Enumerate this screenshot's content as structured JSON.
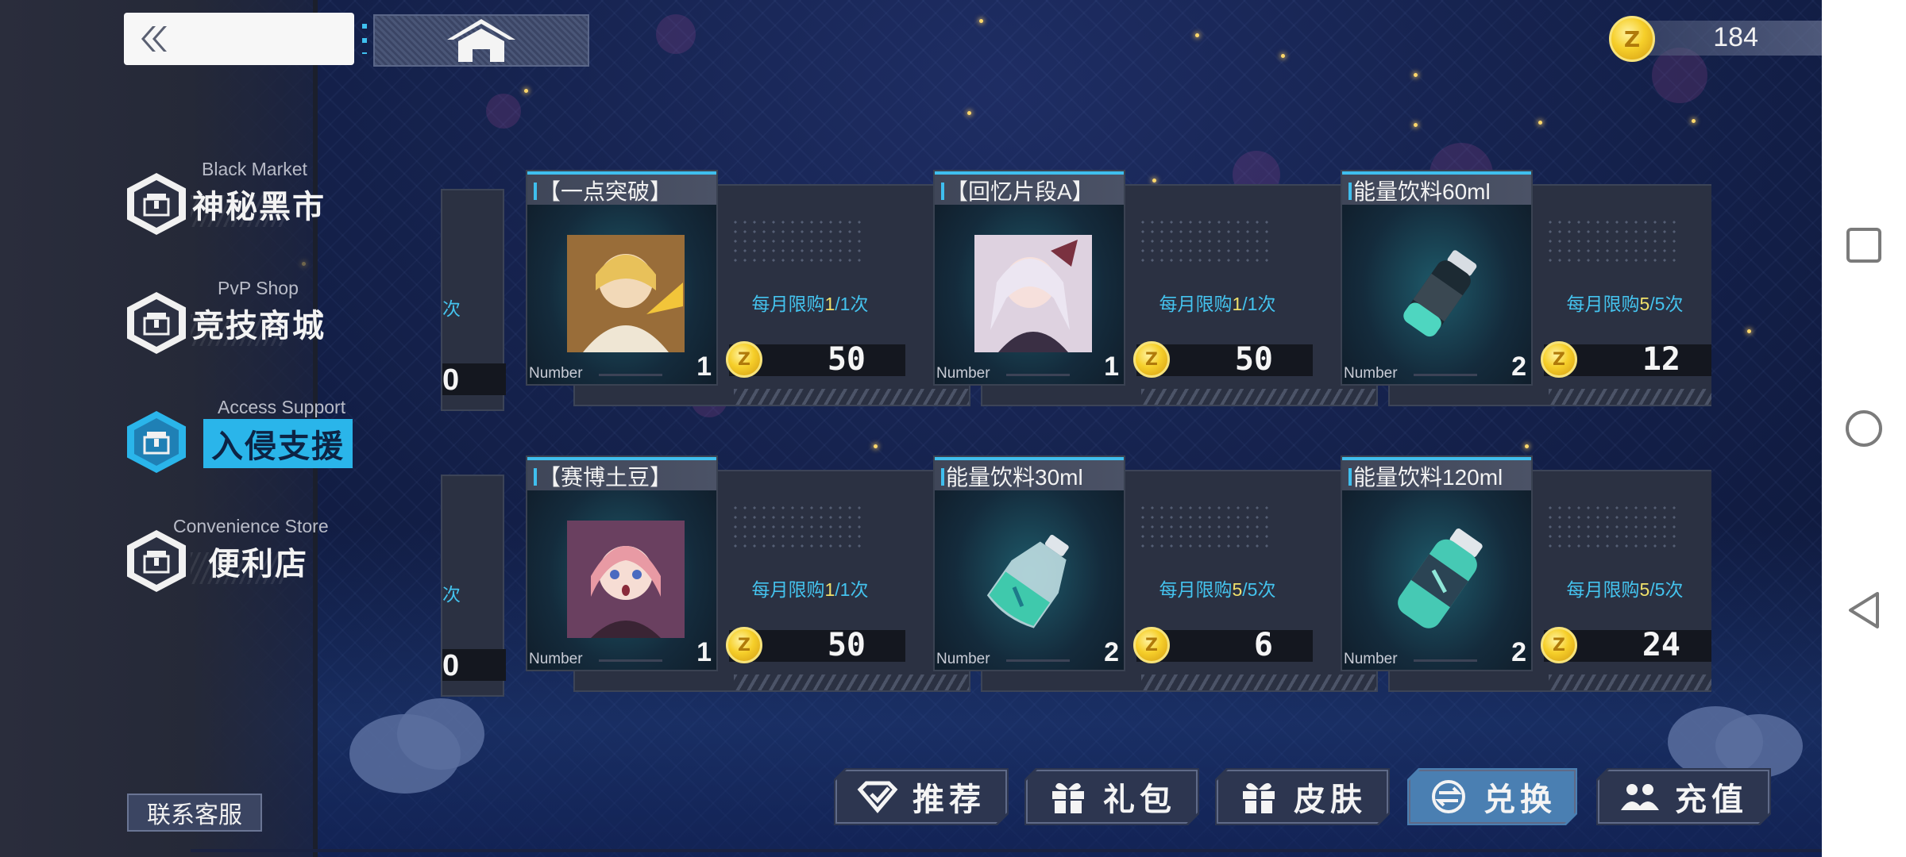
{
  "topbar": {
    "currency_amount": "184",
    "coin_glyph": "Z"
  },
  "sidebar": {
    "items": [
      {
        "en": "Black Market",
        "zh": "神秘黑市"
      },
      {
        "en": "PvP Shop",
        "zh": "竞技商城"
      },
      {
        "en": "Access Support",
        "zh": "入侵支援"
      },
      {
        "en": "Convenience Store",
        "zh": "便利店"
      }
    ],
    "active_index": 2
  },
  "number_label": "Number",
  "partial_cards": [
    {
      "limit_suffix": "次",
      "price_tail": "0"
    },
    {
      "limit_suffix": "次",
      "price_tail": "0"
    }
  ],
  "items": [
    {
      "title": "【一点突破】",
      "qty": "1",
      "limit_prefix": "每月限购",
      "limit_used": "1",
      "limit_total": "/1次",
      "price": "50",
      "image": "character-portrait-blonde"
    },
    {
      "title": "【回忆片段A】",
      "qty": "1",
      "limit_prefix": "每月限购",
      "limit_used": "1",
      "limit_total": "/1次",
      "price": "50",
      "image": "character-portrait-white-hair"
    },
    {
      "title": "能量饮料60ml",
      "qty": "2",
      "limit_prefix": "每月限购",
      "limit_used": "5",
      "limit_total": "/5次",
      "price": "12",
      "image": "energy-drink-bottle"
    },
    {
      "title": "【赛博土豆】",
      "qty": "1",
      "limit_prefix": "每月限购",
      "limit_used": "1",
      "limit_total": "/1次",
      "price": "50",
      "image": "character-portrait-pink-hair"
    },
    {
      "title": "能量饮料30ml",
      "qty": "2",
      "limit_prefix": "每月限购",
      "limit_used": "5",
      "limit_total": "/5次",
      "price": "6",
      "image": "energy-drink-flask"
    },
    {
      "title": "能量饮料120ml",
      "qty": "2",
      "limit_prefix": "每月限购",
      "limit_used": "5",
      "limit_total": "/5次",
      "price": "24",
      "image": "energy-drink-large-bottle"
    }
  ],
  "bottom": {
    "contact_label": "联系客服",
    "tabs": [
      {
        "label": "推荐",
        "icon": "recommend-icon"
      },
      {
        "label": "礼包",
        "icon": "gift-icon"
      },
      {
        "label": "皮肤",
        "icon": "gift-icon"
      },
      {
        "label": "兑换",
        "icon": "exchange-icon"
      },
      {
        "label": "充值",
        "icon": "users-icon"
      }
    ],
    "active_tab": 3
  },
  "colors": {
    "accent_cyan": "#2ab5ea",
    "limit_text": "#44c3ee",
    "limit_highlight": "#f0e06a",
    "coin_gold": "#f6cf2a"
  }
}
